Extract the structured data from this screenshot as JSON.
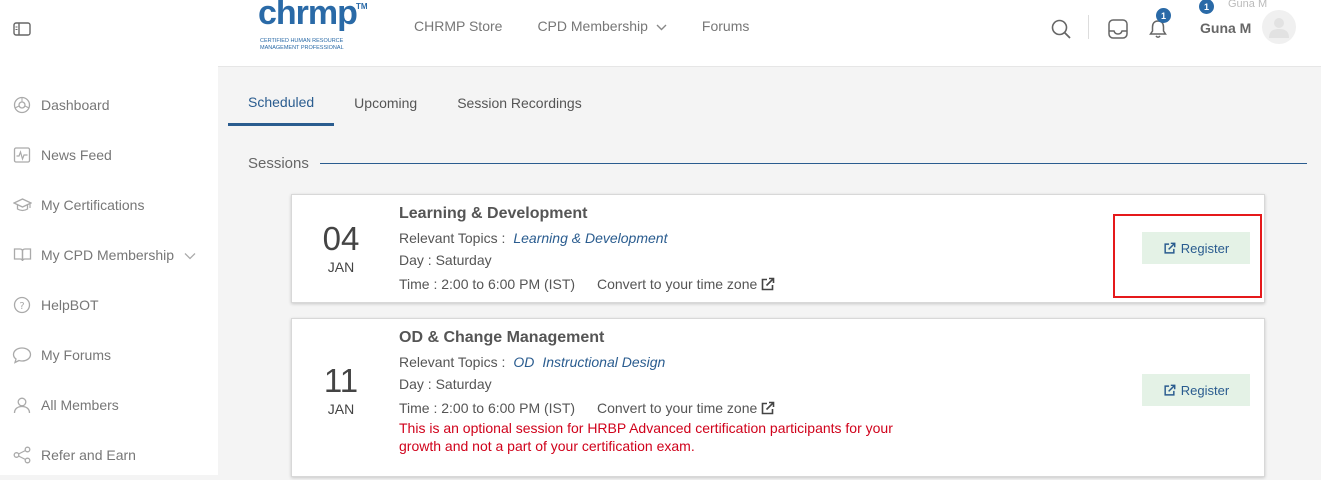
{
  "sidebar": {
    "items": [
      {
        "label": "Dashboard",
        "icon": "dashboard-icon"
      },
      {
        "label": "News Feed",
        "icon": "newsfeed-icon"
      },
      {
        "label": "My Certifications",
        "icon": "certification-icon"
      },
      {
        "label": "My CPD Membership",
        "icon": "book-icon"
      },
      {
        "label": "HelpBOT",
        "icon": "help-icon"
      },
      {
        "label": "My Forums",
        "icon": "chat-icon"
      },
      {
        "label": "All Members",
        "icon": "user-icon"
      },
      {
        "label": "Refer and Earn",
        "icon": "share-icon"
      }
    ]
  },
  "header": {
    "logo": {
      "word": "chrmp",
      "tm": "TM",
      "subtitle": "Certified Human Resource Management Professional"
    },
    "nav": [
      "CHRMP Store",
      "CPD Membership",
      "Forums"
    ],
    "inbox_badge": "1",
    "notification_badge": "1",
    "user_name": "Guna M",
    "ghost_user": "Guna M"
  },
  "tabs": [
    "Scheduled",
    "Upcoming",
    "Session Recordings"
  ],
  "sessions_label": "Sessions",
  "sessions": [
    {
      "day": "04",
      "month": "JAN",
      "title": "Learning & Development",
      "topics_label": "Relevant Topics :",
      "topics": [
        "Learning & Development"
      ],
      "day_of_week": "Day : Saturday",
      "time": "Time : 2:00 to 6:00 PM (IST)",
      "convert": "Convert to your time zone",
      "register": "Register"
    },
    {
      "day": "11",
      "month": "JAN",
      "title": "OD & Change Management",
      "topics_label": "Relevant Topics :",
      "topics": [
        "OD",
        "Instructional Design"
      ],
      "day_of_week": "Day : Saturday",
      "time": "Time : 2:00 to 6:00 PM (IST)",
      "convert": "Convert to your time zone",
      "note": "This is an optional session for HRBP Advanced certification participants for your growth and not a part of your certification exam.",
      "register": "Register"
    }
  ],
  "colors": {
    "accent": "#2a5c8f",
    "register_bg": "#e4f2e6",
    "warning": "#d0021b",
    "highlight": "#e5191b"
  }
}
